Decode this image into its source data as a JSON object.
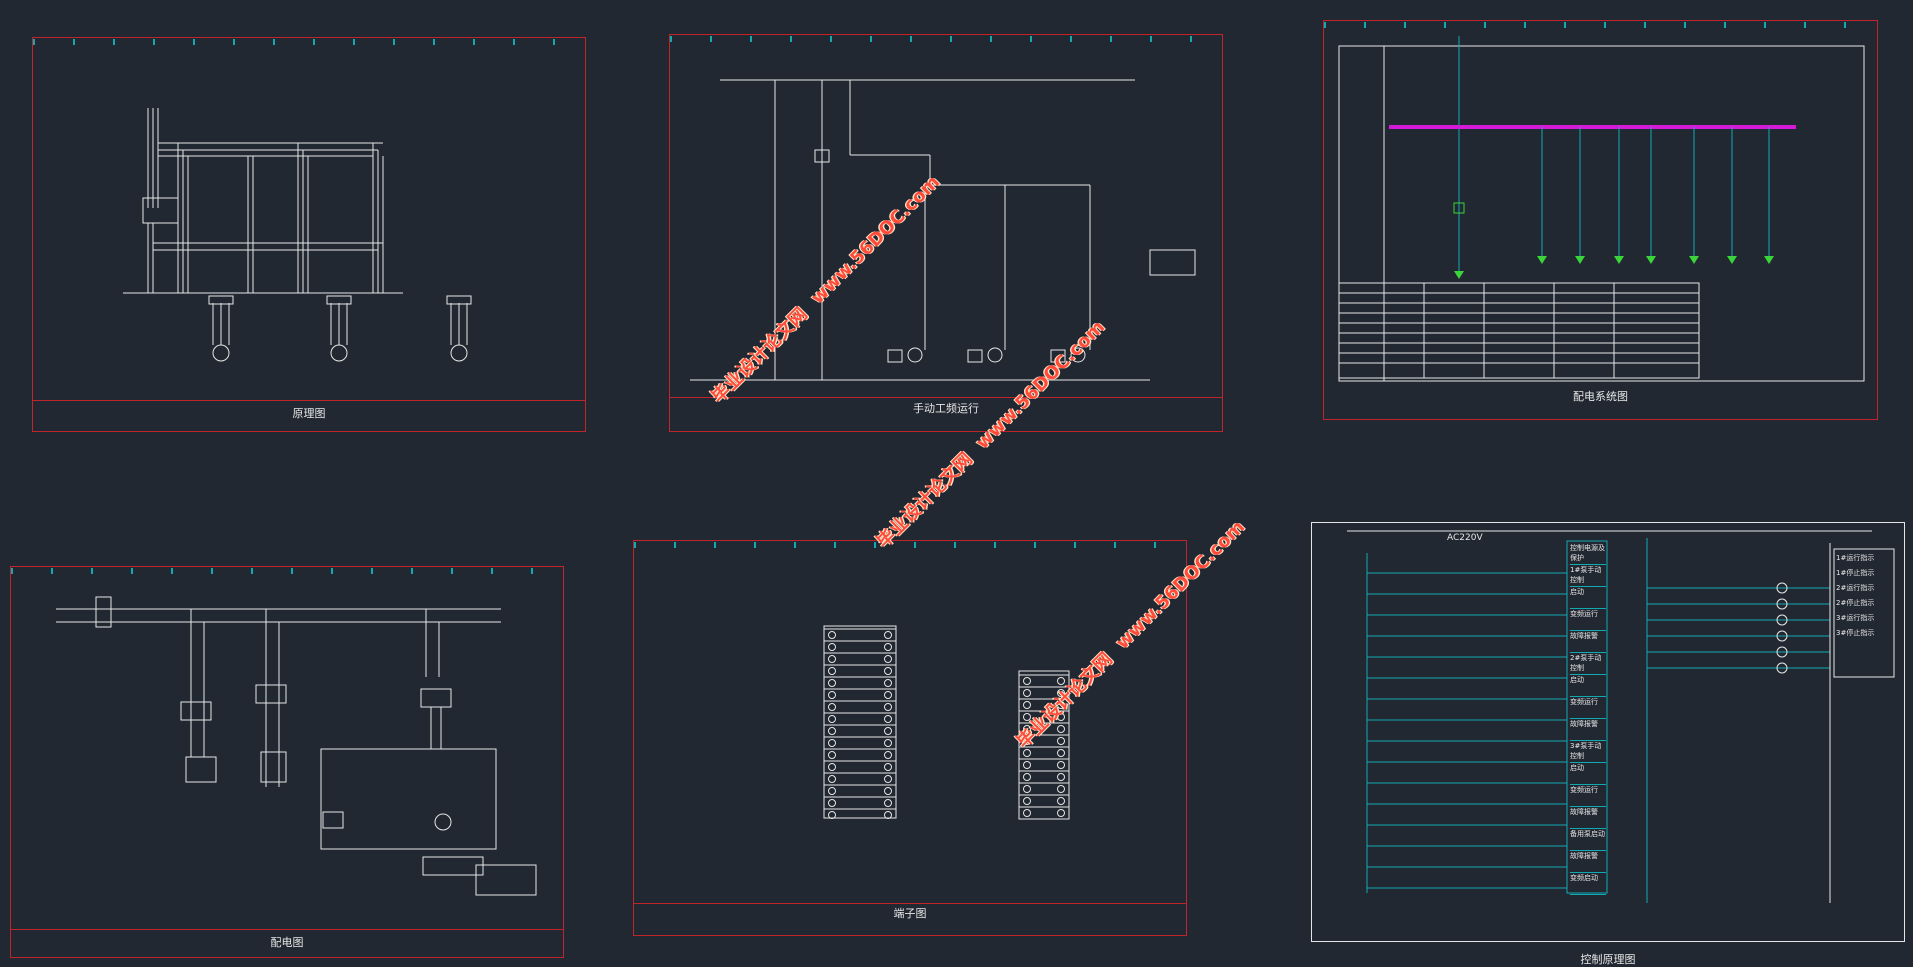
{
  "sheets": {
    "schematic": {
      "caption": "原理图"
    },
    "manual": {
      "caption": "手动工频运行"
    },
    "system": {
      "caption": "配电系统图"
    },
    "distribution": {
      "caption": "配电图"
    },
    "terminal": {
      "caption": "端子图"
    },
    "control": {
      "caption": "控制原理图",
      "header": "AC220V"
    }
  },
  "watermarks": [
    {
      "text": "毕业设计论文网",
      "url": "www.56DOC.com"
    },
    {
      "text": "毕业设计论文网",
      "url": "www.56DOC.com"
    },
    {
      "text": "毕业设计论文网",
      "url": "www.56DOC.com"
    }
  ],
  "control_labels": [
    "控制电源及保护",
    "1#泵手动控制",
    "启动",
    "变频运行",
    "故障报警",
    "2#泵手动控制",
    "启动",
    "变频运行",
    "故障报警",
    "3#泵手动控制",
    "启动",
    "变频运行",
    "故障报警",
    "备用泵启动",
    "故障报警",
    "变频启动"
  ],
  "indicator_labels": [
    "1#运行指示",
    "1#停止指示",
    "2#运行指示",
    "2#停止指示",
    "3#运行指示",
    "3#停止指示"
  ],
  "colors": {
    "background": "#222831",
    "frame": "#c0252b",
    "title_bar": "#13a9b3",
    "bus": "#d21ad8",
    "wire": "#e6e6e6"
  }
}
